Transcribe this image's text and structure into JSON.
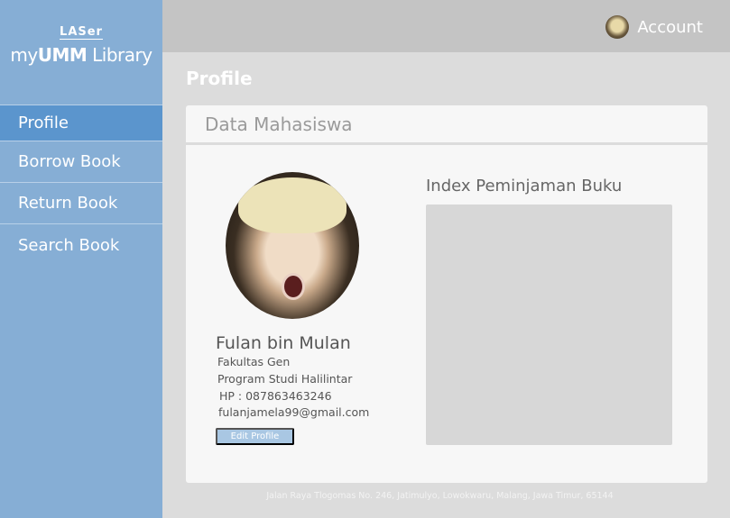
{
  "logo": {
    "top_text": "LASer",
    "brand_prefix": "my",
    "brand_bold": "UMM",
    "brand_suffix": " Library"
  },
  "sidebar": {
    "items": [
      {
        "label": "Profile",
        "active": true
      },
      {
        "label": "Borrow Book"
      },
      {
        "label": "Return Book"
      },
      {
        "label": "Search Book"
      }
    ]
  },
  "header": {
    "account_label": "Account"
  },
  "page": {
    "title": "Profile"
  },
  "card": {
    "title": "Data Mahasiswa",
    "student": {
      "name": "Fulan bin Mulan",
      "faculty": "Fakultas Gen",
      "program": "Program Studi Halilintar",
      "phone": "HP : 087863463246",
      "email": "fulanjamela99@gmail.com"
    },
    "edit_button": "Edit Profile",
    "index_title": "Index Peminjaman Buku"
  },
  "footer": {
    "address": "Jalan Raya Tlogomas No. 246, Jatimulyo, Lowokwaru, Malang, Jawa Timur, 65144"
  },
  "colors": {
    "sidebar": "#86aed5",
    "sidebar_active": "#5b95cd",
    "topbar": "#c4c4c4",
    "background": "#dcdcdc",
    "button": "#a9c7e3"
  }
}
